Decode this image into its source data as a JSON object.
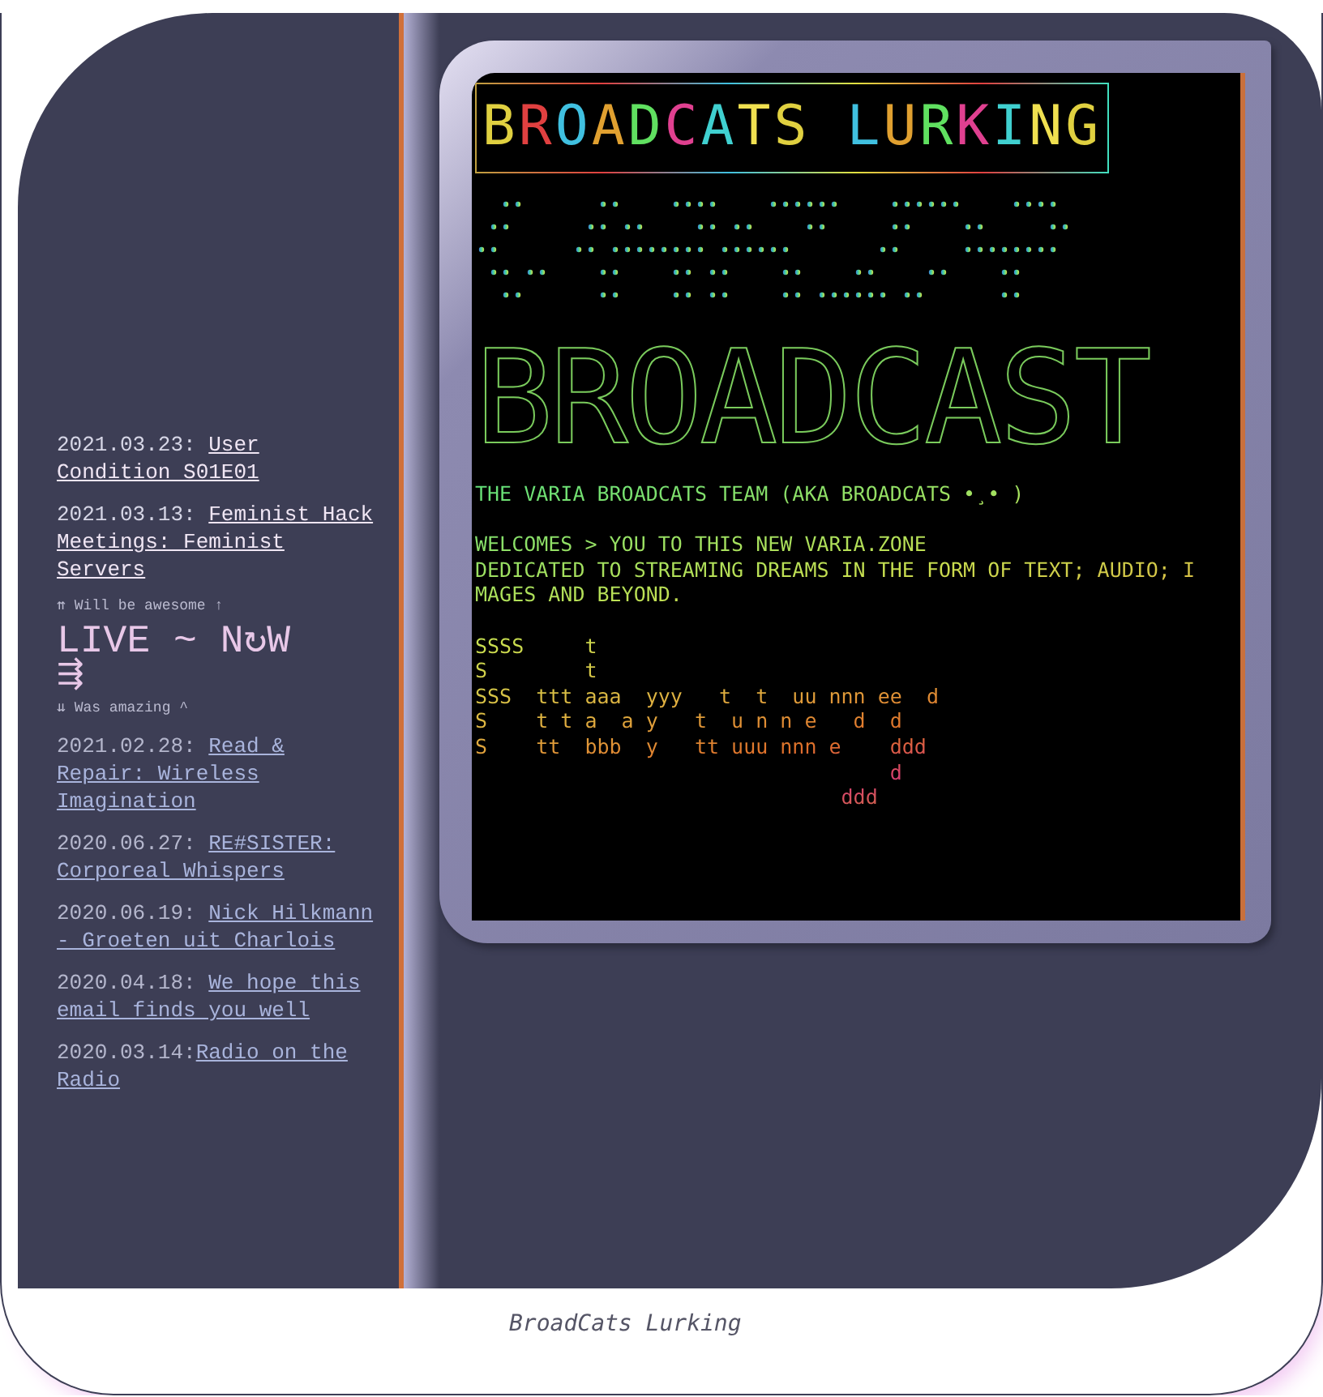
{
  "sidebar": {
    "upcoming": [
      {
        "date": "2021.03.23: ",
        "title": "User Condition S01E01"
      },
      {
        "date": "2021.03.13: ",
        "title": "Feminist Hack Meetings: Feminist Servers"
      }
    ],
    "upcoming_note": "⇈ Will be awesome ↑",
    "live": {
      "text": "LIVE ~ N↻W",
      "arrow": "⇶"
    },
    "past_note": "⇊ Was amazing ^",
    "past": [
      {
        "date": "2021.02.28: ",
        "title": "Read & Repair: Wireless Imagination"
      },
      {
        "date": "2020.06.27: ",
        "title": "RE#SISTER: Corporeal Whispers"
      },
      {
        "date": "2020.06.19: ",
        "title": "Nick Hilkmann - Groeten uit Charlois"
      },
      {
        "date": "2020.04.18: ",
        "title": "We hope this email finds you well"
      },
      {
        "date": "2020.03.14:",
        "title": "Radio on the Radio"
      }
    ]
  },
  "terminal": {
    "title": "BROADCATS LURKING",
    "banner": "BROADCAST",
    "team_line": "THE VARIA BROADCATS TEAM (AKA BROADCATS •¸• )",
    "welcome_lines": [
      "WELCOMES > YOU TO THIS NEW VARIA.ZONE",
      "DEDICATED TO STREAMING DREAMS IN THE FORM OF TEXT; AUDIO; I",
      "MAGES AND BEYOND."
    ],
    "stay_tuned_lines": [
      "SSSS     t",
      "S        t",
      "SSS  ttt aaa  yyy   t  t  uu nnn ee  d",
      "S    t t a  a y   t  u n n e   d  d",
      "S    tt  bbb  y   tt uuu nnn e    ddd",
      "                                  d",
      "                              ddd"
    ]
  },
  "caption": "BroadCats Lurking"
}
